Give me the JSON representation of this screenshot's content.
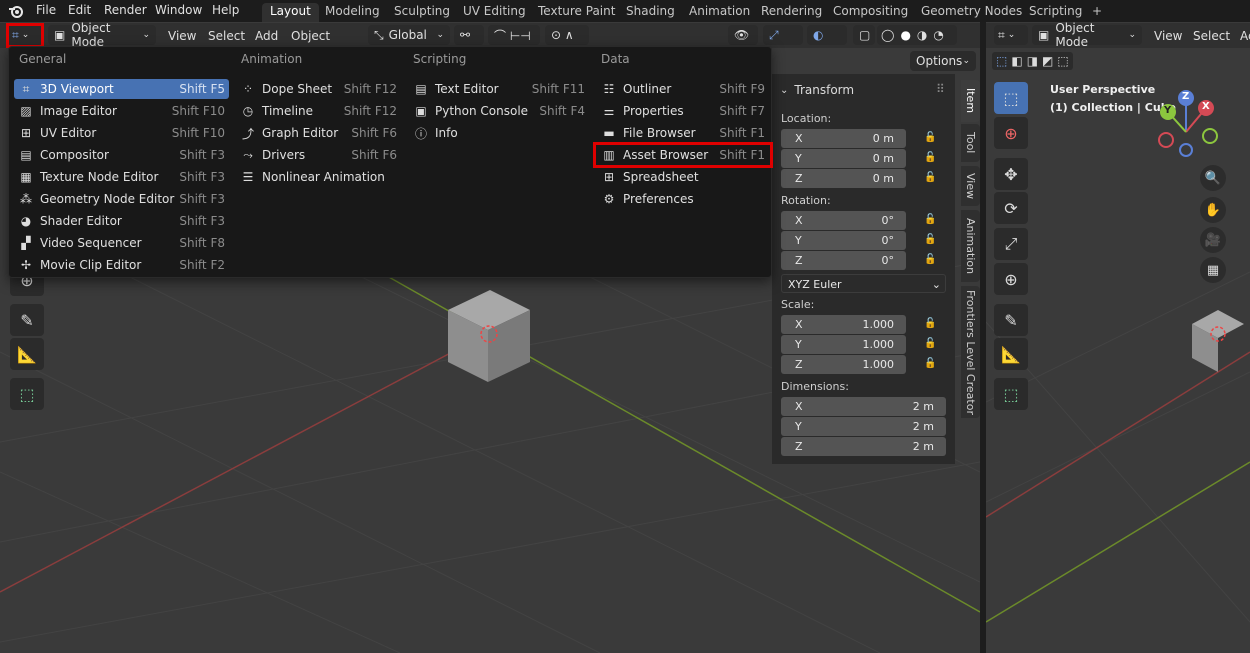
{
  "topbar": {
    "menus": [
      "File",
      "Edit",
      "Render",
      "Window",
      "Help"
    ],
    "workspaces": [
      "Layout",
      "Modeling",
      "Sculpting",
      "UV Editing",
      "Texture Paint",
      "Shading",
      "Animation",
      "Rendering",
      "Compositing",
      "Geometry Nodes",
      "Scripting"
    ],
    "add_tab": "+"
  },
  "header": {
    "mode": "Object Mode",
    "menus": [
      "View",
      "Select",
      "Add",
      "Object"
    ],
    "transform_orientation": "Global",
    "options": "Options"
  },
  "editor_menu": {
    "columns": [
      {
        "title": "General",
        "items": [
          {
            "label": "3D Viewport",
            "shortcut": "Shift F5",
            "icon": "viewport-3d-icon"
          },
          {
            "label": "Image Editor",
            "shortcut": "Shift F10",
            "icon": "image-editor-icon"
          },
          {
            "label": "UV Editor",
            "shortcut": "Shift F10",
            "icon": "uv-editor-icon"
          },
          {
            "label": "Compositor",
            "shortcut": "Shift F3",
            "icon": "compositor-icon"
          },
          {
            "label": "Texture Node Editor",
            "shortcut": "Shift F3",
            "icon": "texture-node-icon"
          },
          {
            "label": "Geometry Node Editor",
            "shortcut": "Shift F3",
            "icon": "geometry-node-icon"
          },
          {
            "label": "Shader Editor",
            "shortcut": "Shift F3",
            "icon": "shader-editor-icon"
          },
          {
            "label": "Video Sequencer",
            "shortcut": "Shift F8",
            "icon": "video-sequencer-icon"
          },
          {
            "label": "Movie Clip Editor",
            "shortcut": "Shift F2",
            "icon": "movie-clip-icon"
          }
        ]
      },
      {
        "title": "Animation",
        "items": [
          {
            "label": "Dope Sheet",
            "shortcut": "Shift F12",
            "icon": "dope-sheet-icon"
          },
          {
            "label": "Timeline",
            "shortcut": "Shift F12",
            "icon": "timeline-icon"
          },
          {
            "label": "Graph Editor",
            "shortcut": "Shift F6",
            "icon": "graph-editor-icon"
          },
          {
            "label": "Drivers",
            "shortcut": "Shift F6",
            "icon": "drivers-icon"
          },
          {
            "label": "Nonlinear Animation",
            "shortcut": "",
            "icon": "nla-icon"
          }
        ]
      },
      {
        "title": "Scripting",
        "items": [
          {
            "label": "Text Editor",
            "shortcut": "Shift F11",
            "icon": "text-editor-icon"
          },
          {
            "label": "Python Console",
            "shortcut": "Shift F4",
            "icon": "console-icon"
          },
          {
            "label": "Info",
            "shortcut": "",
            "icon": "info-icon"
          }
        ]
      },
      {
        "title": "Data",
        "items": [
          {
            "label": "Outliner",
            "shortcut": "Shift F9",
            "icon": "outliner-icon"
          },
          {
            "label": "Properties",
            "shortcut": "Shift F7",
            "icon": "properties-icon"
          },
          {
            "label": "File Browser",
            "shortcut": "Shift F1",
            "icon": "file-browser-icon"
          },
          {
            "label": "Asset Browser",
            "shortcut": "Shift F1",
            "icon": "asset-browser-icon"
          },
          {
            "label": "Spreadsheet",
            "shortcut": "",
            "icon": "spreadsheet-icon"
          },
          {
            "label": "Preferences",
            "shortcut": "",
            "icon": "preferences-icon"
          }
        ]
      }
    ]
  },
  "npanel": {
    "title": "Transform",
    "location_label": "Location:",
    "location": [
      {
        "axis": "X",
        "value": "0 m"
      },
      {
        "axis": "Y",
        "value": "0 m"
      },
      {
        "axis": "Z",
        "value": "0 m"
      }
    ],
    "rotation_label": "Rotation:",
    "rotation": [
      {
        "axis": "X",
        "value": "0°"
      },
      {
        "axis": "Y",
        "value": "0°"
      },
      {
        "axis": "Z",
        "value": "0°"
      }
    ],
    "rotation_mode": "XYZ Euler",
    "scale_label": "Scale:",
    "scale": [
      {
        "axis": "X",
        "value": "1.000"
      },
      {
        "axis": "Y",
        "value": "1.000"
      },
      {
        "axis": "Z",
        "value": "1.000"
      }
    ],
    "dimensions_label": "Dimensions:",
    "dimensions": [
      {
        "axis": "X",
        "value": "2 m"
      },
      {
        "axis": "Y",
        "value": "2 m"
      },
      {
        "axis": "Z",
        "value": "2 m"
      }
    ],
    "tabs": [
      "Item",
      "Tool",
      "View",
      "Animation",
      "Frontiers Level Creator"
    ]
  },
  "viewport2": {
    "mode": "Object Mode",
    "menus": [
      "View",
      "Select",
      "Ac"
    ],
    "perspective": "User Perspective",
    "collection": "(1) Collection | Cube",
    "gizmo": {
      "z": "Z",
      "x": "X",
      "y": "Y"
    }
  },
  "colors": {
    "highlight": "#e00000",
    "selection": "#4772b3"
  }
}
